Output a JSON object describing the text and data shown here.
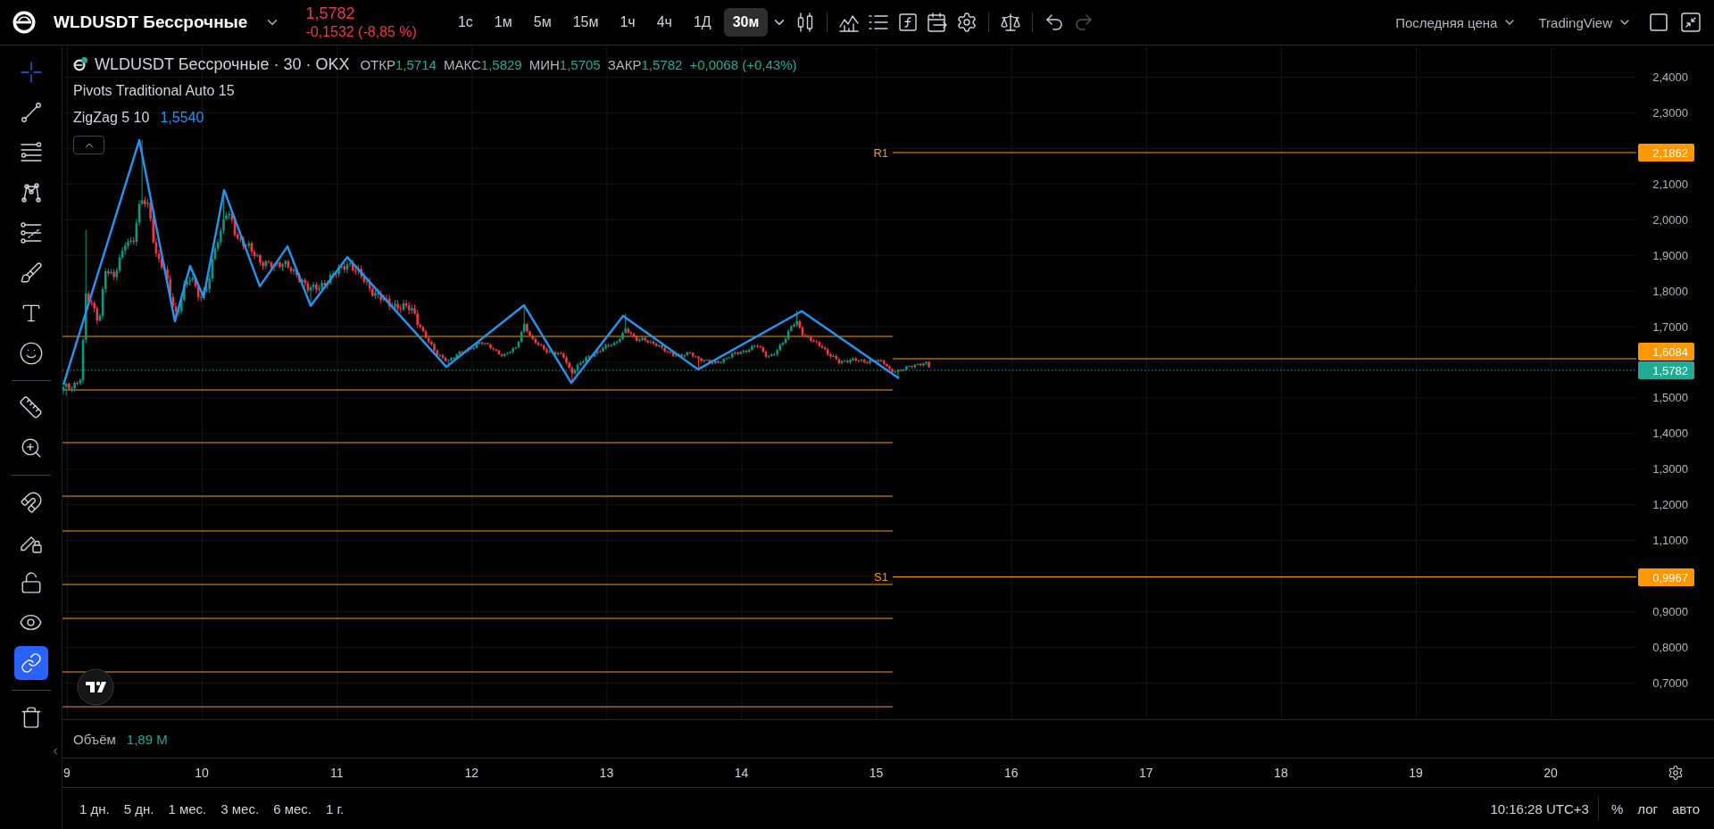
{
  "top_bar": {
    "symbol": "WLDUSDT Бессрочные",
    "price": "1,5782",
    "change": "-0,1532 (-8,85 %)",
    "intervals": [
      {
        "label": "1с",
        "selected": false
      },
      {
        "label": "1м",
        "selected": false
      },
      {
        "label": "5м",
        "selected": false
      },
      {
        "label": "15м",
        "selected": false
      },
      {
        "label": "1ч",
        "selected": false
      },
      {
        "label": "4ч",
        "selected": false
      },
      {
        "label": "1Д",
        "selected": false
      },
      {
        "label": "30м",
        "selected": true
      }
    ],
    "history": [
      {
        "kind": "undo",
        "disabled": false
      },
      {
        "kind": "redo",
        "disabled": true
      }
    ],
    "price_source": "Последняя цена",
    "layout": "TradingView"
  },
  "left_toolbar": {
    "drawing_tools": [
      {
        "kind": "crosshair",
        "selected": true
      },
      {
        "kind": "trend-line",
        "selected": false
      },
      {
        "kind": "fib",
        "selected": false
      },
      {
        "kind": "pattern",
        "selected": false
      },
      {
        "kind": "projection",
        "selected": false
      },
      {
        "kind": "brush",
        "selected": false
      },
      {
        "kind": "text",
        "selected": false
      },
      {
        "kind": "emoji",
        "selected": false
      },
      {
        "kind": "ruler",
        "selected": false
      },
      {
        "kind": "zoom",
        "selected": false
      }
    ],
    "toggles": [
      {
        "kind": "magnet",
        "on": false
      },
      {
        "kind": "lock-pencil",
        "on": false
      },
      {
        "kind": "lock",
        "on": false
      },
      {
        "kind": "eye",
        "on": false
      },
      {
        "kind": "link",
        "on": true
      }
    ]
  },
  "legend": {
    "title": "WLDUSDT Бессрочные · 30 · OKX",
    "ohlc": [
      {
        "label": "ОТКР",
        "value": "1,5714"
      },
      {
        "label": "МАКС",
        "value": "1,5829"
      },
      {
        "label": "МИН",
        "value": "1,5705"
      },
      {
        "label": "ЗАКР",
        "value": "1,5782"
      }
    ],
    "change": "+0,0068 (+0,43%)",
    "indicators": [
      {
        "name": "Pivots Traditional Auto 15"
      },
      {
        "name": "ZigZag 5 10",
        "value": "1,5540"
      }
    ]
  },
  "chart": {
    "pivot_labels": [
      "R1",
      "S1"
    ]
  },
  "price_axis": {
    "labels": [
      "2,4000",
      "2,3000",
      "2,1000",
      "2,0000",
      "1,9000",
      "1,8000",
      "1,7000",
      "1,5000",
      "1,4000",
      "1,3000",
      "1,2000",
      "1,1000",
      "0,9000",
      "0,8000",
      "0,7000"
    ],
    "badges": [
      {
        "text": "2,1862",
        "color": "#ff9800"
      },
      {
        "text": "1,6084",
        "color": "#ff9800"
      },
      {
        "text": "1,5782",
        "color": "#22ab94"
      },
      {
        "text": "0,9967",
        "color": "#ff9800"
      }
    ]
  },
  "volume": {
    "label": "Объём",
    "value": "1,89 M"
  },
  "time_axis": {
    "labels": [
      "9",
      "10",
      "11",
      "12",
      "13",
      "14",
      "15",
      "16",
      "17",
      "18",
      "19",
      "20"
    ]
  },
  "bottom_bar": {
    "ranges": [
      "1 дн.",
      "5 дн.",
      "1 мес.",
      "3 мес.",
      "6 мес.",
      "1 г."
    ],
    "clock": "10:16:28 UTC+3",
    "scale_modes": [
      "%",
      "лог",
      "авто"
    ]
  }
}
